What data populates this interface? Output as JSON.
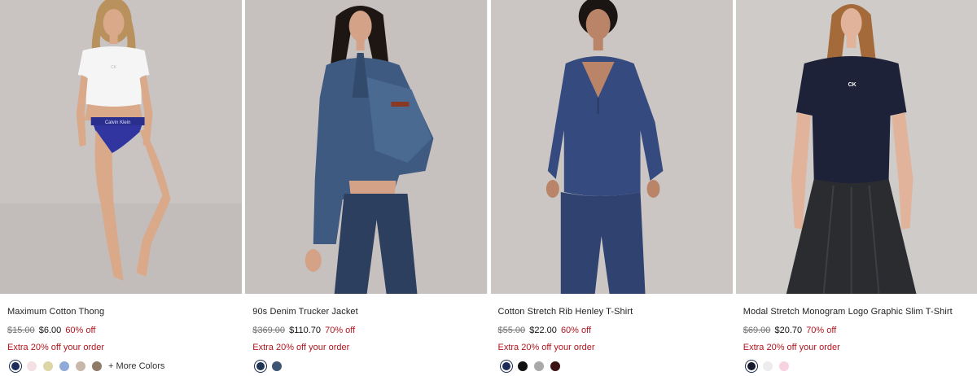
{
  "products": [
    {
      "title": "Maximum Cotton Thong",
      "original_price": "$15.00",
      "sale_price": "$6.00",
      "discount": "60% off",
      "promo": "Extra 20% off your order",
      "swatches": [
        "#1c2b5a",
        "#f4dfe3",
        "#dcd6a6",
        "#8faad8",
        "#c8b8a9",
        "#8e7b68"
      ],
      "more_colors": "+ More Colors"
    },
    {
      "title": "90s Denim Trucker Jacket",
      "original_price": "$369.00",
      "sale_price": "$110.70",
      "discount": "70% off",
      "promo": "Extra 20% off your order",
      "swatches": [
        "#1f3555",
        "#3d5573"
      ]
    },
    {
      "title": "Cotton Stretch Rib Henley T-Shirt",
      "original_price": "$55.00",
      "sale_price": "$22.00",
      "discount": "60% off",
      "promo": "Extra 20% off your order",
      "swatches": [
        "#1c2b5a",
        "#111111",
        "#a9a9a9",
        "#3a1214"
      ]
    },
    {
      "title": "Modal Stretch Monogram Logo Graphic Slim T-Shirt",
      "original_price": "$69.00",
      "sale_price": "$20.70",
      "discount": "70% off",
      "promo": "Extra 20% off your order",
      "swatches": [
        "#161a2c",
        "#ececef",
        "#f7d2e1"
      ]
    }
  ],
  "colors": {
    "price_red": "#b0161e",
    "strike_gray": "#757575",
    "photo_bg": "#c9c4c2"
  },
  "photo_logos": [
    "Calvin Klein",
    "CK"
  ]
}
